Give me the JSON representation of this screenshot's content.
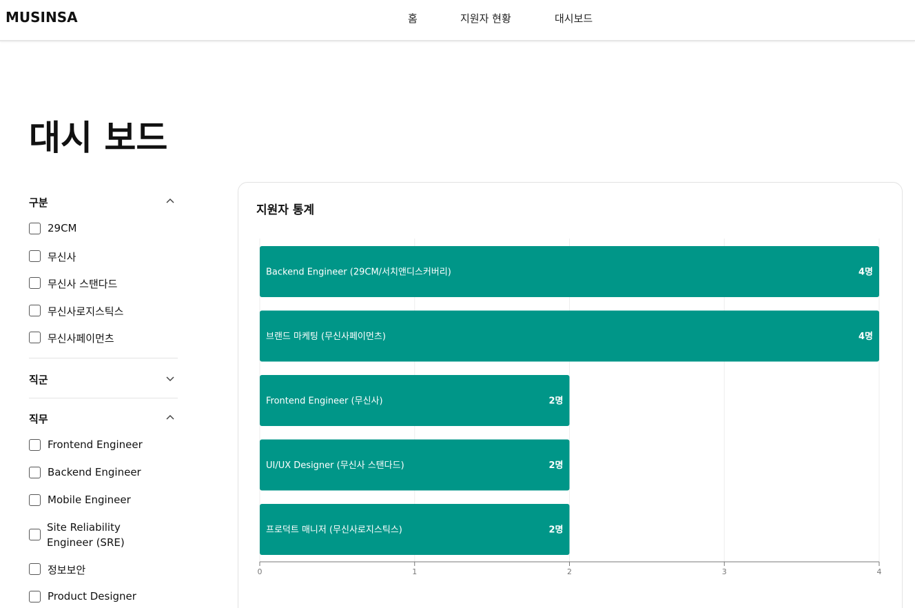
{
  "header": {
    "logo": "MUSINSA",
    "nav": [
      "홈",
      "지원자 현황",
      "대시보드"
    ]
  },
  "page": {
    "title": "대시 보드"
  },
  "filters": {
    "category": {
      "title": "구분",
      "expanded": true,
      "options": [
        "29CM",
        "무신사",
        "무신사 스탠다드",
        "무신사로지스틱스",
        "무신사페이먼츠"
      ]
    },
    "job_group": {
      "title": "직군",
      "expanded": false
    },
    "job": {
      "title": "직무",
      "expanded": true,
      "options": [
        "Frontend Engineer",
        "Backend Engineer",
        "Mobile Engineer",
        "Site Reliability Engineer (SRE)",
        "정보보안",
        "Product Designer"
      ]
    }
  },
  "card": {
    "title": "지원자 통계"
  },
  "colors": {
    "bar": "#009688",
    "grid": "#eeeeee",
    "axis": "#777777"
  },
  "chart_data": {
    "type": "bar",
    "orientation": "horizontal",
    "categories": [
      "Backend Engineer (29CM/서치앤디스커버리)",
      "브랜드 마케팅 (무신사페이먼츠)",
      "Frontend Engineer (무신사)",
      "UI/UX Designer (무신사 스탠다드)",
      "프로덕트 매니저 (무신사로지스틱스)"
    ],
    "values": [
      4,
      4,
      2,
      2,
      2
    ],
    "value_labels": [
      "4명",
      "4명",
      "2명",
      "2명",
      "2명"
    ],
    "xlim": [
      0,
      4
    ],
    "xticks": [
      "0",
      "1",
      "2",
      "3",
      "4"
    ],
    "grid": true
  }
}
